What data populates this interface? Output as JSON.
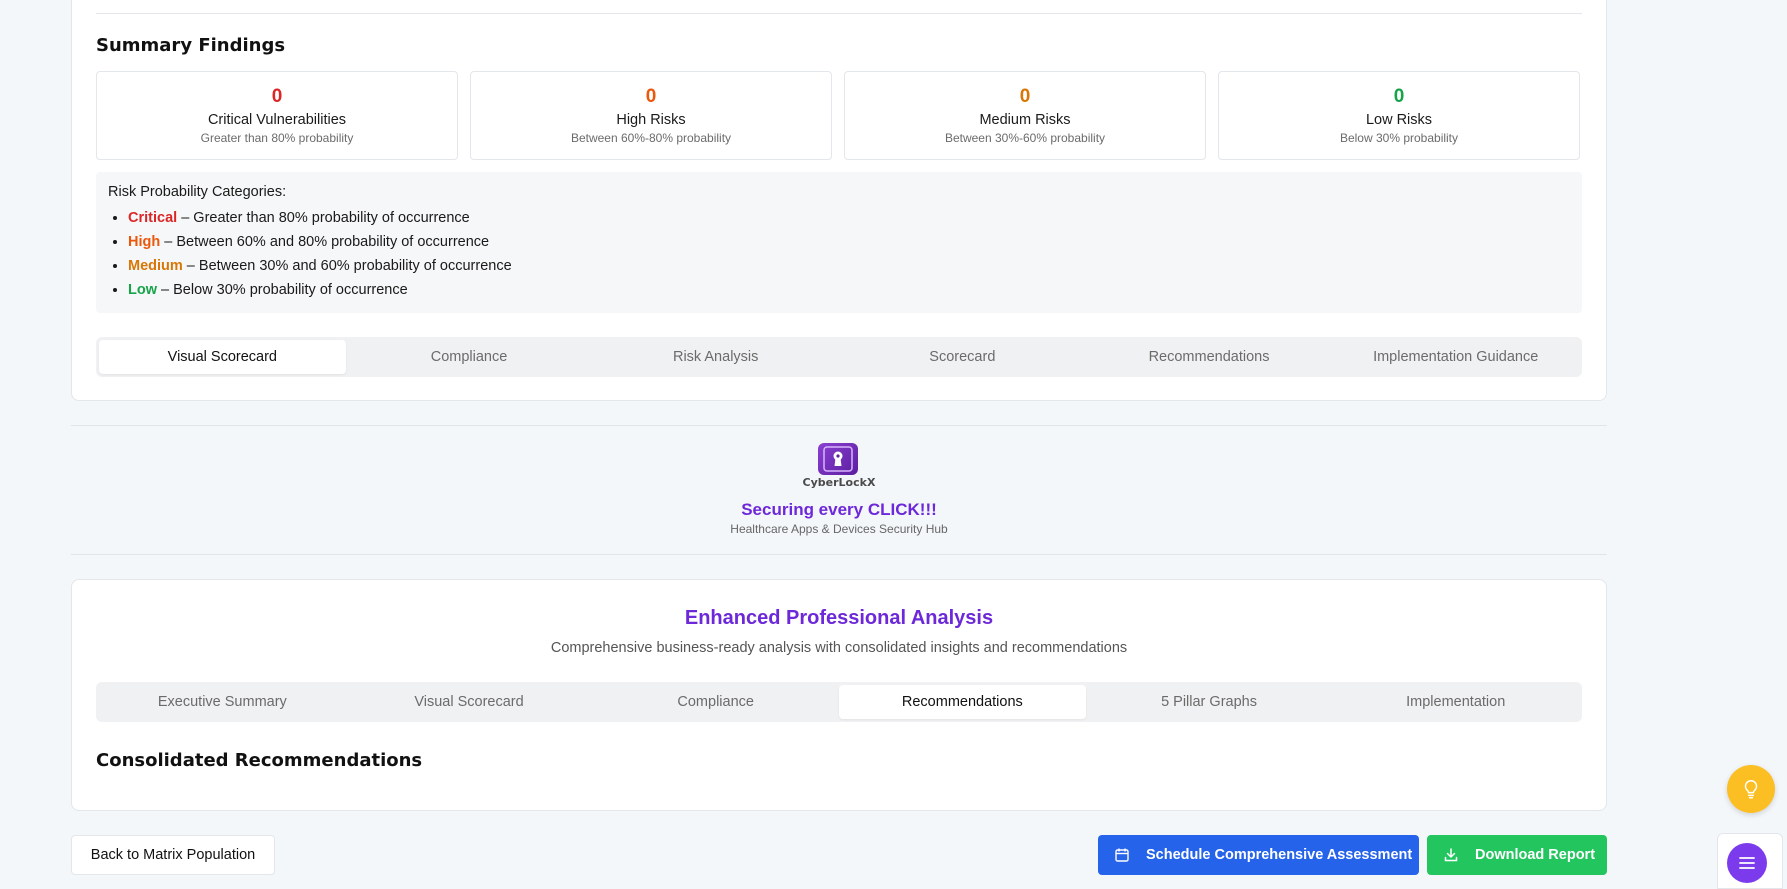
{
  "summary": {
    "title": "Summary Findings",
    "stats": [
      {
        "count": "0",
        "title": "Critical Vulnerabilities",
        "sub": "Greater than 80% probability",
        "color": "#dc2626"
      },
      {
        "count": "0",
        "title": "High Risks",
        "sub": "Between 60%-80% probability",
        "color": "#ea580c"
      },
      {
        "count": "0",
        "title": "Medium Risks",
        "sub": "Between 30%-60% probability",
        "color": "#d97706"
      },
      {
        "count": "0",
        "title": "Low Risks",
        "sub": "Below 30% probability",
        "color": "#16a34a"
      }
    ],
    "legend": {
      "heading": "Risk Probability Categories:",
      "items": [
        {
          "level": "Critical",
          "text": " – Greater than 80% probability of occurrence",
          "color": "#dc2626"
        },
        {
          "level": "High",
          "text": " – Between 60% and 80% probability of occurrence",
          "color": "#ea580c"
        },
        {
          "level": "Medium",
          "text": " – Between 30% and 60% probability of occurrence",
          "color": "#d97706"
        },
        {
          "level": "Low",
          "text": " – Below 30% probability of occurrence",
          "color": "#16a34a"
        }
      ]
    },
    "tabs": [
      "Visual Scorecard",
      "Compliance",
      "Risk Analysis",
      "Scorecard",
      "Recommendations",
      "Implementation Guidance"
    ],
    "active_tab": "Visual Scorecard"
  },
  "brand": {
    "logo_text": "CyberLockX",
    "tagline": "Securing every CLICK!!!",
    "subtitle": "Healthcare Apps & Devices Security Hub"
  },
  "analysis": {
    "title": "Enhanced Professional Analysis",
    "subtitle": "Comprehensive business-ready analysis with consolidated insights and recommendations",
    "tabs": [
      "Executive Summary",
      "Visual Scorecard",
      "Compliance",
      "Recommendations",
      "5 Pillar Graphs",
      "Implementation"
    ],
    "active_tab": "Recommendations",
    "section_title": "Consolidated Recommendations"
  },
  "actions": {
    "back": "Back to Matrix Population",
    "schedule": "Schedule Comprehensive Assessment",
    "download": "Download Report"
  },
  "colors": {
    "accent_purple": "#6d28d9",
    "button_blue": "#2563eb",
    "button_green": "#22c55e",
    "fab_yellow": "#fbbf24"
  }
}
